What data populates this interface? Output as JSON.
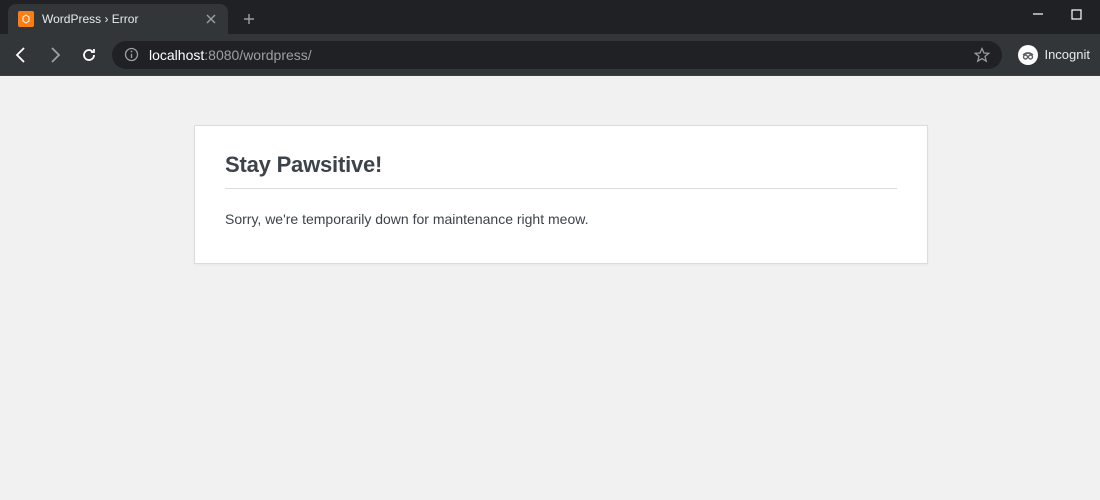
{
  "browser": {
    "tab_title": "WordPress › Error",
    "url_host": "localhost",
    "url_port_path": ":8080/wordpress/",
    "incognito_label": "Incognit"
  },
  "page": {
    "heading": "Stay Pawsitive!",
    "message": "Sorry, we're temporarily down for maintenance right meow."
  }
}
